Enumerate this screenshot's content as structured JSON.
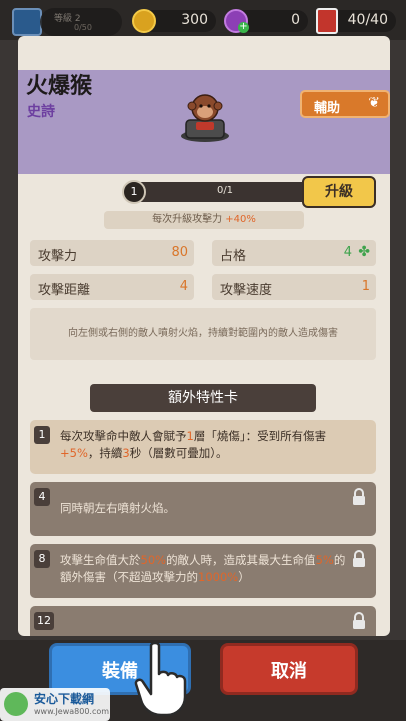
{
  "hud": {
    "level_label": "等級 2",
    "exp": "0/50",
    "coins": "300",
    "gems": "0",
    "cards": "40/40"
  },
  "unit": {
    "name": "火爆猴",
    "rarity": "史詩",
    "role_button": "輔助",
    "progress_level": "1",
    "progress_text": "0/1",
    "upgrade_button": "升級",
    "per_upgrade_label": "每次升級攻擊力 ",
    "per_upgrade_value": "+40%",
    "stats": [
      {
        "label": "攻擊力",
        "value": "80"
      },
      {
        "label": "占格",
        "value": "4"
      },
      {
        "label": "攻擊距離",
        "value": "4"
      },
      {
        "label": "攻擊速度",
        "value": "1"
      }
    ],
    "description": "向左側或右側的敵人噴射火焰，持續對範圍內的敵人造成傷害"
  },
  "traits": {
    "title": "額外特性卡",
    "items": [
      {
        "num": "1",
        "parts": [
          "每次攻擊命中敵人會賦予",
          "1",
          "層「燒傷」：受到所有傷害",
          "+5%",
          "，持續",
          "3",
          "秒（層數可疊加）。"
        ]
      },
      {
        "num": "4",
        "text": "同時朝左右噴射火焰。"
      },
      {
        "num": "8",
        "parts": [
          "攻擊生命值大於",
          "50%",
          "的敵人時，造成其最大生命值",
          "5%",
          "的額外傷害（不超過攻擊力的",
          "1000%",
          "）"
        ]
      },
      {
        "num": "12",
        "text": ""
      }
    ]
  },
  "buttons": {
    "equip": "裝備",
    "cancel": "取消"
  },
  "watermark": {
    "title": "安心下載網",
    "url": "www.Jewa800.com"
  },
  "colors": {
    "header_purple": "#a999c4",
    "accent_orange": "#d9792a",
    "equip_blue": "#3b8ee0",
    "cancel_red": "#c63a2c"
  }
}
